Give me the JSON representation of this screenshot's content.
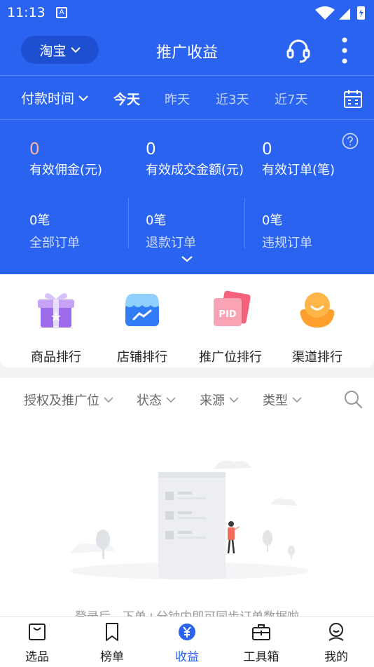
{
  "status_bar": {
    "time": "11:13",
    "notification_glyph": "A"
  },
  "header": {
    "platform_label": "淘宝",
    "title": "推广收益"
  },
  "date_bar": {
    "selector_label": "付款时间",
    "tabs": [
      "今天",
      "昨天",
      "近3天",
      "近7天"
    ],
    "active_tab": "今天"
  },
  "stats": {
    "main": [
      {
        "value": "0",
        "label": "有效佣金(元)"
      },
      {
        "value": "0",
        "label": "有效成交金额(元)"
      },
      {
        "value": "0",
        "label": "有效订单(笔)"
      }
    ],
    "orders": [
      {
        "count": "0",
        "unit": "笔",
        "label": "全部订单"
      },
      {
        "count": "0",
        "unit": "笔",
        "label": "退款订单"
      },
      {
        "count": "0",
        "unit": "笔",
        "label": "违规订单"
      }
    ]
  },
  "shortcuts": [
    {
      "label": "商品排行",
      "icon": "gift-icon"
    },
    {
      "label": "店铺排行",
      "icon": "store-icon"
    },
    {
      "label": "推广位排行",
      "icon": "pid-icon"
    },
    {
      "label": "渠道排行",
      "icon": "smiley-avatar-icon"
    }
  ],
  "filters": [
    "授权及推广位",
    "状态",
    "来源",
    "类型"
  ],
  "empty_state": {
    "pid_text": "PID",
    "hint": "登录后，下单+分钟内即可同步订单数据啦"
  },
  "tab_bar": [
    {
      "label": "选品",
      "icon": "bag-icon"
    },
    {
      "label": "榜单",
      "icon": "bookmark-icon"
    },
    {
      "label": "收益",
      "icon": "yen-icon",
      "active": true
    },
    {
      "label": "工具箱",
      "icon": "toolbox-icon"
    },
    {
      "label": "我的",
      "icon": "profile-icon"
    }
  ],
  "colors": {
    "primary": "#2a63f0",
    "commission_value": "#ffb4a0",
    "platform_pill": "#1d4fd0"
  }
}
